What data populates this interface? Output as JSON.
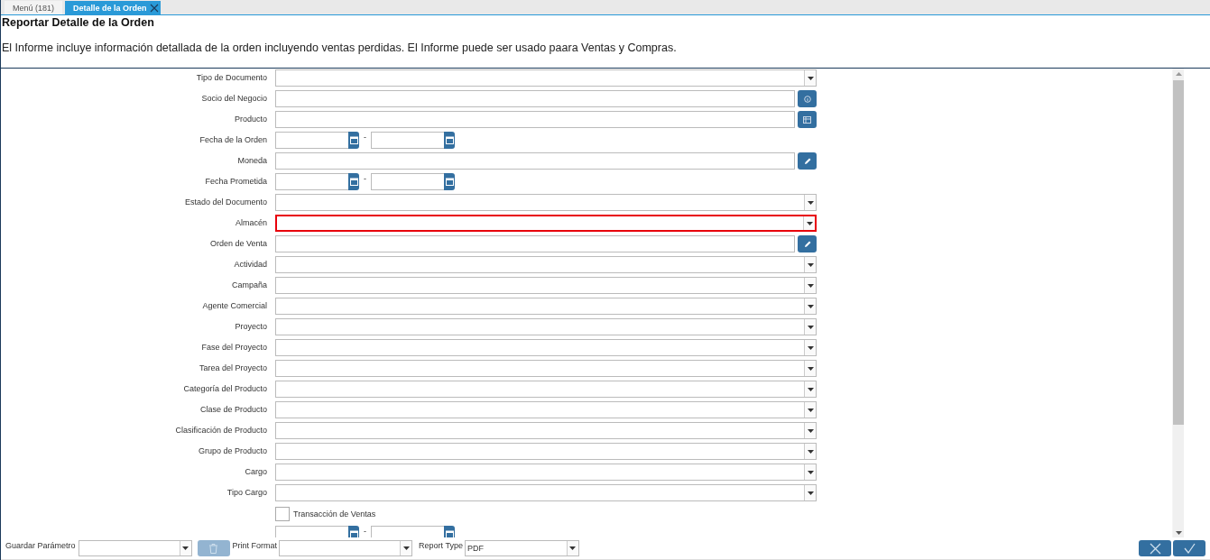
{
  "tabs": [
    {
      "label": "Menú (181)",
      "selected": false,
      "closable": false
    },
    {
      "label": "Detalle de la Orden",
      "selected": true,
      "closable": true
    }
  ],
  "report": {
    "title": "Reportar Detalle de la Orden",
    "description": "El Informe incluye información detallada de la orden incluyendo ventas perdidas. El Informe puede ser usado paara Ventas y Compras."
  },
  "parameters": [
    {
      "kind": "select",
      "label": "Tipo de Documento",
      "mandatory": false
    },
    {
      "kind": "search-partner",
      "label": "Socio del Negocio",
      "mandatory": false
    },
    {
      "kind": "search-product",
      "label": "Producto",
      "mandatory": false
    },
    {
      "kind": "date-range",
      "label": "Fecha de la Orden",
      "separator": "-",
      "mandatory": false
    },
    {
      "kind": "search",
      "label": "Moneda",
      "mandatory": false
    },
    {
      "kind": "date-range",
      "label": "Fecha Prometida",
      "separator": "-",
      "mandatory": false
    },
    {
      "kind": "select",
      "label": "Estado del Documento",
      "mandatory": false
    },
    {
      "kind": "select",
      "label": "Almacén",
      "mandatory": true
    },
    {
      "kind": "search",
      "label": "Orden de Venta",
      "mandatory": false
    },
    {
      "kind": "select",
      "label": "Actividad",
      "mandatory": false
    },
    {
      "kind": "select",
      "label": "Campaña",
      "mandatory": false
    },
    {
      "kind": "select",
      "label": "Agente Comercial",
      "mandatory": false
    },
    {
      "kind": "select",
      "label": "Proyecto",
      "mandatory": false
    },
    {
      "kind": "select",
      "label": "Fase del Proyecto",
      "mandatory": false
    },
    {
      "kind": "select",
      "label": "Tarea del Proyecto",
      "mandatory": false
    },
    {
      "kind": "select",
      "label": "Categoría del Producto",
      "mandatory": false
    },
    {
      "kind": "select",
      "label": "Clase de Producto",
      "mandatory": false
    },
    {
      "kind": "select",
      "label": "Clasificación de Producto",
      "mandatory": false
    },
    {
      "kind": "select",
      "label": "Grupo de Producto",
      "mandatory": false
    },
    {
      "kind": "select",
      "label": "Cargo",
      "mandatory": false
    },
    {
      "kind": "select",
      "label": "Tipo Cargo",
      "mandatory": false
    },
    {
      "kind": "checkbox",
      "label": "Transacción de Ventas",
      "checked": false
    },
    {
      "kind": "date-range",
      "separator": "-",
      "mandatory": false
    }
  ],
  "footer": {
    "save_label": "Guardar Parámetro",
    "delete_disabled": true,
    "print_format_label": "Print Format",
    "report_type_label": "Report Type",
    "report_type_value": "PDF"
  }
}
